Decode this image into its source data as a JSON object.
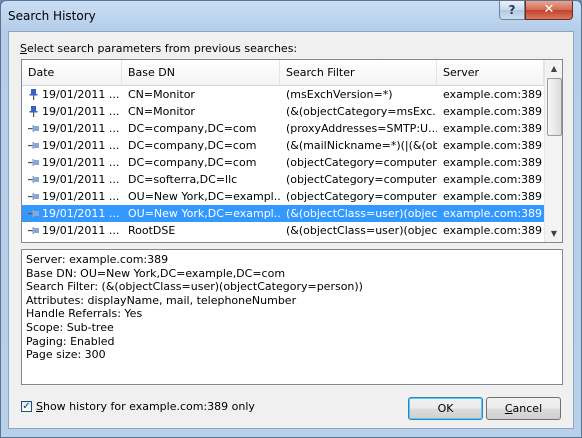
{
  "window": {
    "title": "Search History",
    "help_label": "?",
    "close_label": "✕"
  },
  "prompt": {
    "first_letter": "S",
    "rest": "elect search parameters from previous searches:"
  },
  "table": {
    "columns": [
      "Date",
      "Base DN",
      "Search Filter",
      "Server"
    ],
    "rows": [
      {
        "pinned": true,
        "date": "19/01/2011 ...",
        "base_dn": "CN=Monitor",
        "filter": "(msExchVersion=*)",
        "server": "example.com:389"
      },
      {
        "pinned": true,
        "date": "19/01/2011 ...",
        "base_dn": "CN=Monitor",
        "filter": "(&(objectCategory=msExc...",
        "server": "example.com:389"
      },
      {
        "pinned": false,
        "date": "19/01/2011 ...",
        "base_dn": "DC=company,DC=com",
        "filter": "(proxyAddresses=SMTP:U...",
        "server": "example.com:389"
      },
      {
        "pinned": false,
        "date": "19/01/2011 ...",
        "base_dn": "DC=company,DC=com",
        "filter": "(&(mailNickname=*)(|(&(ob...",
        "server": "example.com:389"
      },
      {
        "pinned": false,
        "date": "19/01/2011 ...",
        "base_dn": "DC=company,DC=com",
        "filter": "(objectCategory=computer)",
        "server": "example.com:389"
      },
      {
        "pinned": false,
        "date": "19/01/2011 ...",
        "base_dn": "DC=softerra,DC=llc",
        "filter": "(objectCategory=computer)",
        "server": "example.com:389"
      },
      {
        "pinned": false,
        "date": "19/01/2011 ...",
        "base_dn": "OU=New York,DC=exampl...",
        "filter": "(objectCategory=computer)",
        "server": "example.com:389"
      },
      {
        "pinned": false,
        "selected": true,
        "date": "19/01/2011 ...",
        "base_dn": "OU=New York,DC=exampl...",
        "filter": "(&(objectClass=user)(object...",
        "server": "example.com:389"
      },
      {
        "pinned": false,
        "date": "19/01/2011 ...",
        "base_dn": "RootDSE",
        "filter": "(&(objectClass=user)(objec...",
        "server": "example.com:389"
      }
    ]
  },
  "details": [
    "Server: example.com:389",
    "Base DN: OU=New York,DC=example,DC=com",
    "Search Filter: (&(objectClass=user)(objectCategory=person))",
    "Attributes: displayName, mail, telephoneNumber",
    "Handle Referrals: Yes",
    "Scope: Sub-tree",
    "Paging: Enabled",
    "Page size: 300"
  ],
  "show_history": {
    "checked": true,
    "first_letter": "S",
    "rest": "how history for example.com:389 only"
  },
  "buttons": {
    "ok": "OK",
    "cancel_first": "C",
    "cancel_rest": "ancel"
  },
  "colors": {
    "selection": "#3399ff",
    "pin_active": "#3a5fcd",
    "pin_inactive": "#8aa6d6"
  }
}
